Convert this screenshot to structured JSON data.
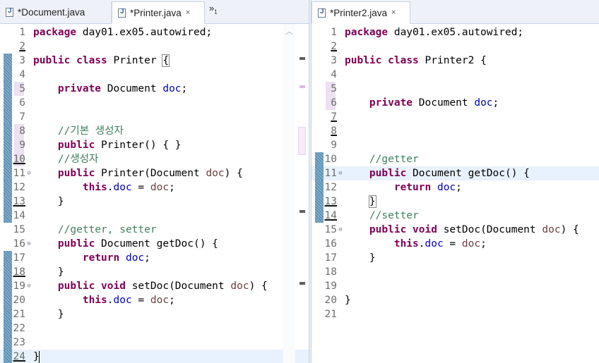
{
  "left_editor": {
    "tabs": [
      {
        "label": "*Document.java",
        "active": false
      },
      {
        "label": "*Printer.java",
        "active": true,
        "close_icon": "×"
      }
    ],
    "overflow_label": "»",
    "overflow_count": "1",
    "lines": [
      {
        "n": "1",
        "text": "package day01.ex05.autowired;"
      },
      {
        "n": "2",
        "text": ""
      },
      {
        "n": "3",
        "text": "public class Printer {"
      },
      {
        "n": "4",
        "text": ""
      },
      {
        "n": "5",
        "text": "    private Document doc;"
      },
      {
        "n": "6",
        "text": ""
      },
      {
        "n": "7",
        "text": ""
      },
      {
        "n": "8",
        "text": "    //기본 생성자"
      },
      {
        "n": "9",
        "text": "    public Printer() { }"
      },
      {
        "n": "10",
        "text": "    //생성자"
      },
      {
        "n": "11",
        "text": "    public Printer(Document doc) {"
      },
      {
        "n": "12",
        "text": "        this.doc = doc;"
      },
      {
        "n": "13",
        "text": "    }"
      },
      {
        "n": "14",
        "text": ""
      },
      {
        "n": "15",
        "text": "    //getter, setter"
      },
      {
        "n": "16",
        "text": "    public Document getDoc() {"
      },
      {
        "n": "17",
        "text": "        return doc;"
      },
      {
        "n": "18",
        "text": "    }"
      },
      {
        "n": "19",
        "text": "    public void setDoc(Document doc) {"
      },
      {
        "n": "20",
        "text": "        this.doc = doc;"
      },
      {
        "n": "21",
        "text": "    }"
      },
      {
        "n": "22",
        "text": ""
      },
      {
        "n": "23",
        "text": ""
      },
      {
        "n": "24",
        "text": "}"
      }
    ]
  },
  "right_editor": {
    "tabs": [
      {
        "label": "*Printer2.java",
        "active": true,
        "close_icon": "×"
      }
    ],
    "lines": [
      {
        "n": "1",
        "text": "package day01.ex05.autowired;"
      },
      {
        "n": "2",
        "text": ""
      },
      {
        "n": "3",
        "text": "public class Printer2 {"
      },
      {
        "n": "4",
        "text": ""
      },
      {
        "n": "5",
        "text": ""
      },
      {
        "n": "6",
        "text": "    private Document doc;"
      },
      {
        "n": "7",
        "text": ""
      },
      {
        "n": "8",
        "text": ""
      },
      {
        "n": "9",
        "text": ""
      },
      {
        "n": "10",
        "text": "    //getter"
      },
      {
        "n": "11",
        "text": "    public Document getDoc() {"
      },
      {
        "n": "12",
        "text": "        return doc;"
      },
      {
        "n": "13",
        "text": "    }"
      },
      {
        "n": "14",
        "text": "    //setter"
      },
      {
        "n": "15",
        "text": "    public void setDoc(Document doc) {"
      },
      {
        "n": "16",
        "text": "        this.doc = doc;"
      },
      {
        "n": "17",
        "text": "    }"
      },
      {
        "n": "18",
        "text": ""
      },
      {
        "n": "19",
        "text": ""
      },
      {
        "n": "20",
        "text": "}"
      },
      {
        "n": "21",
        "text": ""
      }
    ]
  },
  "colors": {
    "keyword": "#7f0055",
    "field": "#0000c0",
    "parameter": "#6a3e3e",
    "comment": "#3f7f5f",
    "current_line": "#e8f2fe",
    "quick_diff": "#5d91b6"
  },
  "icons": {
    "file_icon": "java-file-icon",
    "close_icon": "close-icon",
    "fold_icon": "collapse-fold-icon",
    "scroll_up": "chevron-up-icon"
  }
}
